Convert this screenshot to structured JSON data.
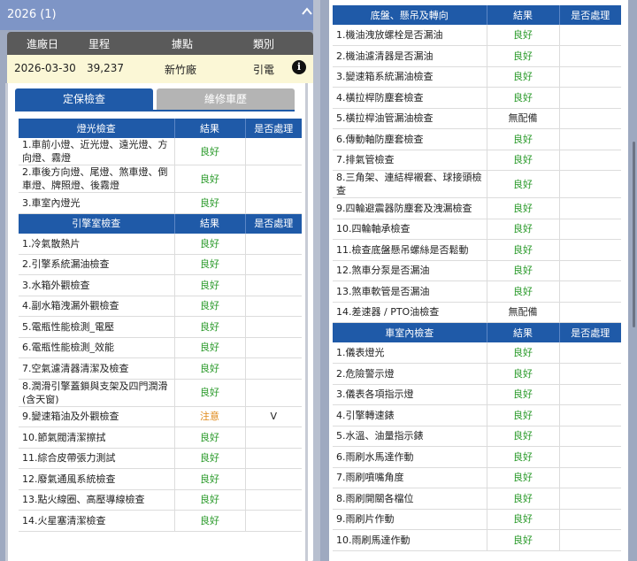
{
  "year_bar": {
    "label": "2026 (1)"
  },
  "visit": {
    "headers": [
      "進廠日",
      "里程",
      "據點",
      "類別"
    ],
    "row": {
      "date": "2026-03-30",
      "mileage": "39,237",
      "site": "新竹廠",
      "category": "引電",
      "info_icon": "i"
    }
  },
  "tabs": [
    {
      "label": "定保檢查"
    },
    {
      "label": "維修車歷"
    }
  ],
  "left_sections": [
    {
      "header": [
        "燈光檢查",
        "結果",
        "是否處理"
      ],
      "rows": [
        {
          "item": "1.車前小燈、近光燈、遠光燈、方向燈、霧燈",
          "result": "良好",
          "handled": ""
        },
        {
          "item": "2.車後方向燈、尾燈、煞車燈、倒車燈、牌照燈、後霧燈",
          "result": "良好",
          "handled": ""
        },
        {
          "item": "3.車室內燈光",
          "result": "良好",
          "handled": ""
        }
      ]
    },
    {
      "header": [
        "引擎室檢查",
        "結果",
        "是否處理"
      ],
      "rows": [
        {
          "item": "1.冷氣散熱片",
          "result": "良好",
          "handled": ""
        },
        {
          "item": "2.引擎系統漏油檢查",
          "result": "良好",
          "handled": ""
        },
        {
          "item": "3.水箱外觀檢查",
          "result": "良好",
          "handled": ""
        },
        {
          "item": "4.副水箱洩漏外觀檢查",
          "result": "良好",
          "handled": ""
        },
        {
          "item": "5.電瓶性能檢測_電壓",
          "result": "良好",
          "handled": ""
        },
        {
          "item": "6.電瓶性能檢測_效能",
          "result": "良好",
          "handled": ""
        },
        {
          "item": "7.空氣濾清器清潔及檢查",
          "result": "良好",
          "handled": ""
        },
        {
          "item": "8.潤滑引擎蓋鎖與支架及四門潤滑(含天窗)",
          "result": "良好",
          "handled": ""
        },
        {
          "item": "9.變速箱油及外觀檢查",
          "result": "注意",
          "handled": "V"
        },
        {
          "item": "10.節氣閥清潔擦拭",
          "result": "良好",
          "handled": ""
        },
        {
          "item": "11.綜合皮帶張力測試",
          "result": "良好",
          "handled": ""
        },
        {
          "item": "12.廢氣通風系統檢查",
          "result": "良好",
          "handled": ""
        },
        {
          "item": "13.點火線圈、高壓導線檢查",
          "result": "良好",
          "handled": ""
        },
        {
          "item": "14.火星塞清潔檢查",
          "result": "良好",
          "handled": ""
        }
      ]
    }
  ],
  "right_sections": [
    {
      "header": [
        "底盤、懸吊及轉向",
        "結果",
        "是否處理"
      ],
      "rows": [
        {
          "item": "1.機油洩放螺栓是否漏油",
          "result": "良好",
          "handled": ""
        },
        {
          "item": "2.機油濾清器是否漏油",
          "result": "良好",
          "handled": ""
        },
        {
          "item": "3.變速箱系統漏油檢查",
          "result": "良好",
          "handled": ""
        },
        {
          "item": "4.橫拉桿防塵套檢查",
          "result": "良好",
          "handled": ""
        },
        {
          "item": "5.橫拉桿油管漏油檢查",
          "result": "無配備",
          "handled": ""
        },
        {
          "item": "6.傳動軸防塵套檢查",
          "result": "良好",
          "handled": ""
        },
        {
          "item": "7.排氣管檢查",
          "result": "良好",
          "handled": ""
        },
        {
          "item": "8.三角架、連結桿襯套、球接頭檢查",
          "result": "良好",
          "handled": ""
        },
        {
          "item": "9.四輪避震器防塵套及洩漏檢查",
          "result": "良好",
          "handled": ""
        },
        {
          "item": "10.四輪軸承檢查",
          "result": "良好",
          "handled": ""
        },
        {
          "item": "11.檢查底盤懸吊螺絲是否鬆動",
          "result": "良好",
          "handled": ""
        },
        {
          "item": "12.煞車分泵是否漏油",
          "result": "良好",
          "handled": ""
        },
        {
          "item": "13.煞車軟管是否漏油",
          "result": "良好",
          "handled": ""
        },
        {
          "item": "14.差速器 / PTO油檢查",
          "result": "無配備",
          "handled": ""
        }
      ]
    },
    {
      "header": [
        "車室內檢查",
        "結果",
        "是否處理"
      ],
      "rows": [
        {
          "item": "1.儀表燈光",
          "result": "良好",
          "handled": ""
        },
        {
          "item": "2.危險警示燈",
          "result": "良好",
          "handled": ""
        },
        {
          "item": "3.儀表各項指示燈",
          "result": "良好",
          "handled": ""
        },
        {
          "item": "4.引擎轉速錶",
          "result": "良好",
          "handled": ""
        },
        {
          "item": "5.水溫、油量指示錶",
          "result": "良好",
          "handled": ""
        },
        {
          "item": "6.雨刷水馬達作動",
          "result": "良好",
          "handled": ""
        },
        {
          "item": "7.雨刷噴嘴角度",
          "result": "良好",
          "handled": ""
        },
        {
          "item": "8.雨刷開關各檔位",
          "result": "良好",
          "handled": ""
        },
        {
          "item": "9.雨刷片作動",
          "result": "良好",
          "handled": ""
        },
        {
          "item": "10.雨刷馬達作動",
          "result": "良好",
          "handled": ""
        }
      ]
    }
  ],
  "colors": {
    "header_blue": "#1f5aa8",
    "good": "#2a9a2a",
    "warn": "#e08a1a"
  },
  "icons": {
    "collapse": "chevron-up-icon",
    "info": "info-icon"
  }
}
